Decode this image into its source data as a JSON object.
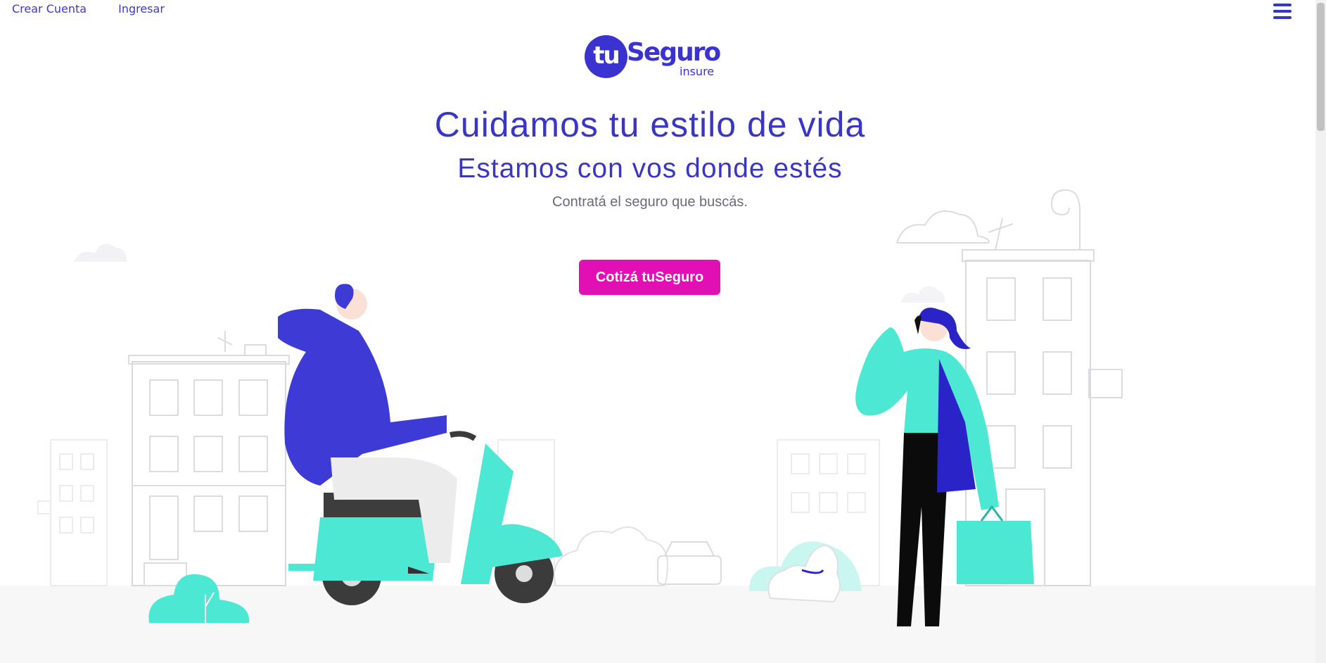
{
  "nav": {
    "create_account": "Crear Cuenta",
    "login": "Ingresar"
  },
  "logo": {
    "circle": "tu",
    "word": "Seguro",
    "sub": "insure"
  },
  "hero": {
    "title": "Cuidamos tu estilo de vida",
    "subtitle": "Estamos con vos donde estés",
    "tagline": "Contratá el seguro que buscás.",
    "cta": "Cotizá tuSeguro"
  },
  "colors": {
    "brand": "#3b33cf",
    "cta": "#e20fb5",
    "teal": "#4de8d4",
    "text_muted": "#6a6a7a"
  },
  "icons": {
    "menu": "hamburger-menu-icon"
  }
}
